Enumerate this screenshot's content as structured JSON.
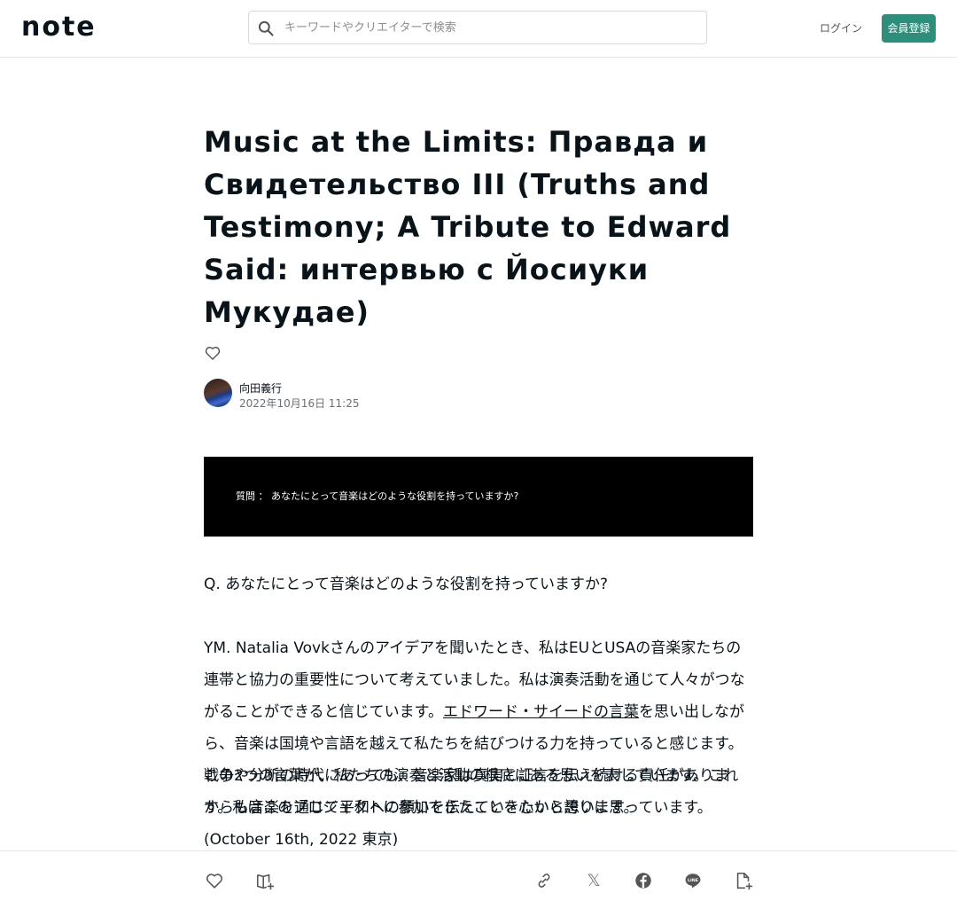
{
  "header": {
    "logo": "note",
    "search_placeholder": "キーワードやクリエイターで検索",
    "login_label": "ログイン",
    "signup_label": "会員登録"
  },
  "article": {
    "title": "Music at the Limits: Правда и Свидетельство III (Truths and Testimony; A Tribute to Edward Said: интервью с Йосиуки Мукудае)",
    "author_name": "向田義行",
    "date": "2022年10月16日 11:25",
    "banner_text": "質問 ： あなたにとって音楽はどのような役割を持っていますか?",
    "question": "Q.   あなたにとって音楽はどのような役割を持っていますか?",
    "answer_part1": "YM.  Natalia Vovkさんのアイデアを聞いたとき、私はEUとUSAの音楽家たちの連帯と協力の重要性について考えていました。私は演奏活動を通じて人々がつながることができると信じています。",
    "answer_link": "エドワード・サイードの言葉",
    "answer_part2": "を思い出しながら、音楽は国境や言語を越えて私たちを結びつける力を持っていると感じます。戦争や分断の時代にあっても、音楽家は真実と証言を伝え続ける責任があります。私はこのプロジェクトに参加できたことを心から誇りに思っています。",
    "paragraph2": "この2つの言葉が、私たちの演奏と活動の根底にある思いを表しています。これからも音楽を通じて平和への願いを伝えていきたいと思います。",
    "signature": "(October 16th, 2022 東京)"
  },
  "icons": {
    "search": "search-icon",
    "heart": "heart-icon",
    "magazine_add": "magazine-add-icon",
    "link": "link-icon",
    "x": "x-share-icon",
    "facebook": "facebook-icon",
    "line": "line-icon",
    "embed": "embed-icon"
  },
  "colors": {
    "accent": "#2c8f7b",
    "text": "#08131a",
    "banner_bg": "#000000"
  }
}
